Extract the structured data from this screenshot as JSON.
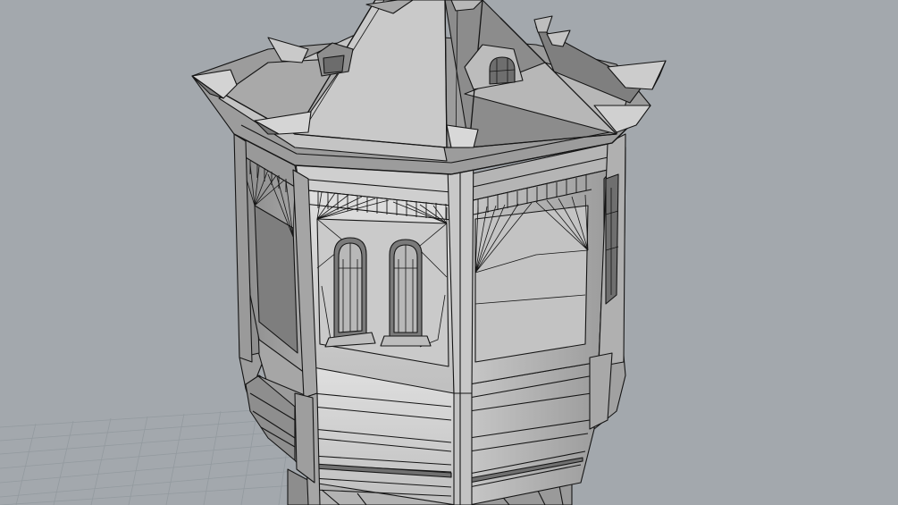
{
  "viewport": {
    "background": "#a3a8ad",
    "grid_color": "#8f959b",
    "model_edge_color": "#151515",
    "face_light": "#d6d6d6",
    "face_mid": "#bdbdbd",
    "face_dark": "#8a8a8a",
    "shadow": "#555555"
  }
}
